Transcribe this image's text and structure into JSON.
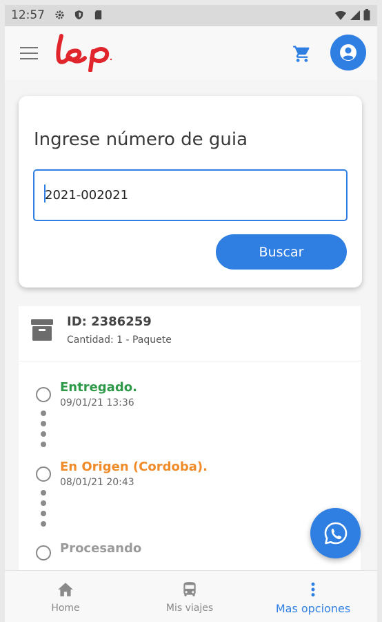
{
  "status_bar": {
    "time": "12:57"
  },
  "app_bar": {
    "logo_text": "lep",
    "colors": {
      "brand_red": "#e0262c",
      "accent_blue": "#2f7fe3"
    }
  },
  "search": {
    "title": "Ingrese número de guia",
    "input_value": "2021-002021",
    "button_label": "Buscar"
  },
  "result": {
    "id_label": "ID: 2386259",
    "quantity_label": "Cantidad: 1 - Paquete",
    "timeline": [
      {
        "status": "Entregado.",
        "date": "09/01/21 13:36",
        "color": "#2e9a49"
      },
      {
        "status": "En Origen (Cordoba).",
        "date": "08/01/21 20:43",
        "color": "#f08b2a"
      },
      {
        "status": "Procesando",
        "date": "",
        "color": "#9a9a9a"
      }
    ]
  },
  "bottom_nav": {
    "items": [
      {
        "label": "Home",
        "icon": "home-icon",
        "active": false
      },
      {
        "label": "Mis viajes",
        "icon": "bus-icon",
        "active": false
      },
      {
        "label": "Mas opciones",
        "icon": "more-vert-icon",
        "active": true
      }
    ]
  }
}
